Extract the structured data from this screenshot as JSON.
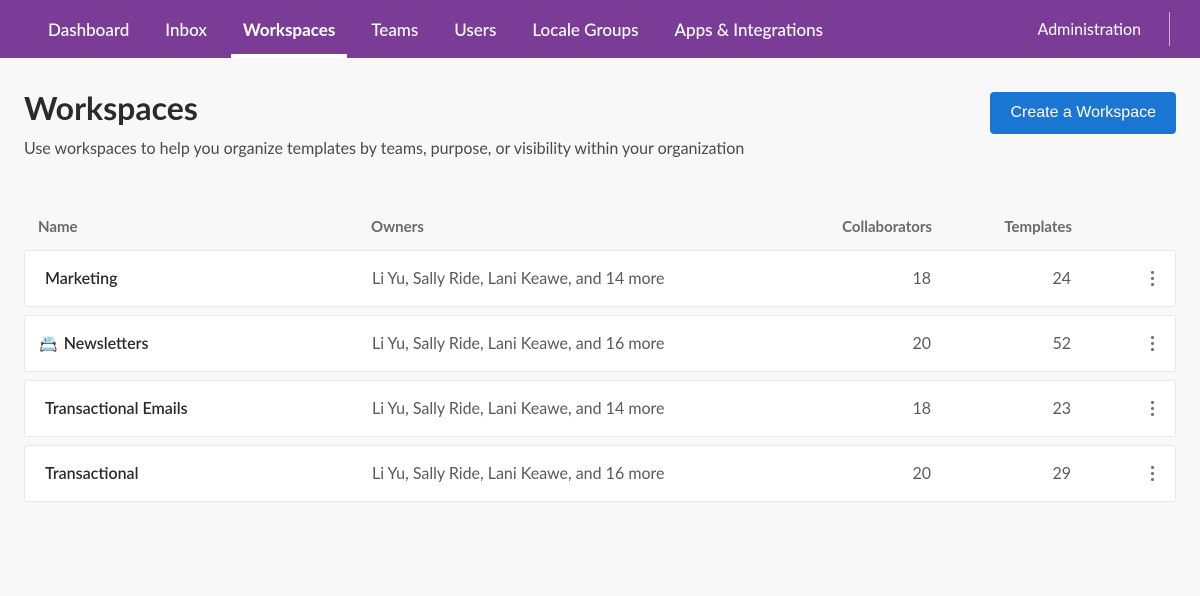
{
  "nav": {
    "items": [
      {
        "label": "Dashboard"
      },
      {
        "label": "Inbox"
      },
      {
        "label": "Workspaces",
        "active": true
      },
      {
        "label": "Teams"
      },
      {
        "label": "Users"
      },
      {
        "label": "Locale Groups"
      },
      {
        "label": "Apps & Integrations"
      }
    ],
    "admin": "Administration"
  },
  "header": {
    "title": "Workspaces",
    "subtitle": "Use workspaces to help you organize templates by teams, purpose, or visibility within your organization",
    "cta": "Create a Workspace"
  },
  "table": {
    "columns": {
      "name": "Name",
      "owners": "Owners",
      "collaborators": "Collaborators",
      "templates": "Templates"
    },
    "rows": [
      {
        "icon": "",
        "name": "Marketing",
        "owners": "Li Yu, Sally Ride, Lani Keawe, and 14 more",
        "collaborators": "18",
        "templates": "24"
      },
      {
        "icon": "📇",
        "name": "Newsletters",
        "owners": "Li Yu, Sally Ride, Lani Keawe, and 16 more",
        "collaborators": "20",
        "templates": "52"
      },
      {
        "icon": "",
        "name": "Transactional Emails",
        "owners": "Li Yu, Sally Ride, Lani Keawe, and 14 more",
        "collaborators": "18",
        "templates": "23"
      },
      {
        "icon": "",
        "name": "Transactional",
        "owners": "Li Yu, Sally Ride, Lani Keawe, and 16 more",
        "collaborators": "20",
        "templates": "29"
      }
    ]
  }
}
